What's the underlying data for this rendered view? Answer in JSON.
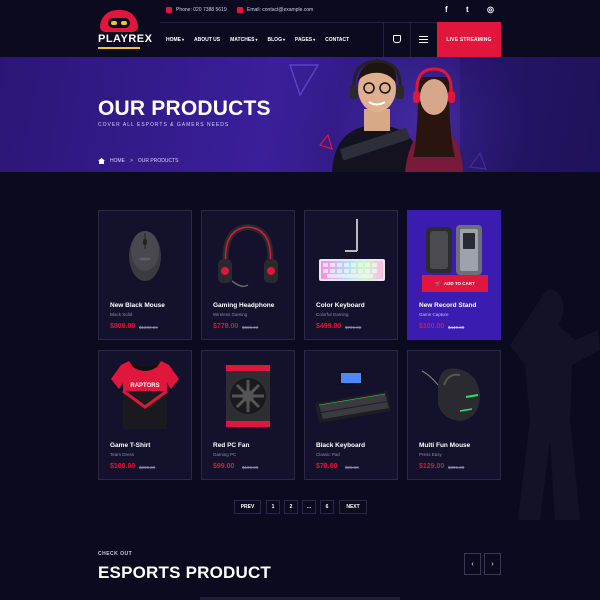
{
  "brand": {
    "name": "PLAYREX",
    "accent": "#e1163c",
    "yellow": "#f2c230"
  },
  "topbar": {
    "phone": "Phone: 020 7388 5619",
    "email": "Email: contact@example.com",
    "social": [
      {
        "icon": "facebook-icon",
        "glyph": "f"
      },
      {
        "icon": "twitter-icon",
        "glyph": "t"
      },
      {
        "icon": "instagram-icon",
        "glyph": "◎"
      }
    ]
  },
  "nav": {
    "items": [
      {
        "label": "HOME",
        "dropdown": true
      },
      {
        "label": "ABOUT US",
        "dropdown": false
      },
      {
        "label": "MATCHES",
        "dropdown": true
      },
      {
        "label": "BLOG",
        "dropdown": true
      },
      {
        "label": "PAGES",
        "dropdown": true
      },
      {
        "label": "CONTACT",
        "dropdown": false
      }
    ],
    "live_label": "LIVE STREAMING"
  },
  "banner": {
    "title": "OUR PRODUCTS",
    "subtitle": "COVER ALL ESPORTS & GAMERS NEEDS",
    "breadcrumb": [
      "HOME",
      ">",
      "OUR PRODUCTS"
    ]
  },
  "products": [
    {
      "name": "New Black Mouse",
      "sub": "Black Solid",
      "price": "$800.00",
      "old": "$1200.00",
      "kind": "mouse"
    },
    {
      "name": "Gaming Headphone",
      "sub": "Wireless Gaming",
      "price": "$778.00",
      "old": "$899.00",
      "kind": "headphone"
    },
    {
      "name": "Color Keyboard",
      "sub": "Colorful Gaming",
      "price": "$499.00",
      "old": "$799.00",
      "kind": "keyboard"
    },
    {
      "name": "New Record Stand",
      "sub": "Game Capture",
      "price": "$100.00",
      "old": "$440.00",
      "kind": "capture",
      "active": true
    },
    {
      "name": "Game T-Shirt",
      "sub": "Team Dress",
      "price": "$100.00",
      "old": "$800.00",
      "kind": "tshirt"
    },
    {
      "name": "Red PC Fan",
      "sub": "Gaming PC",
      "price": "$99.00",
      "old": "$199.00",
      "kind": "fan"
    },
    {
      "name": "Black Keyboard",
      "sub": "Classic Pad",
      "price": "$78.00",
      "old": "$98.00",
      "kind": "blackkeyboard"
    },
    {
      "name": "Multi Fun Mouse",
      "sub": "Press Easy",
      "price": "$129.00",
      "old": "$399.00",
      "kind": "rgbmouse"
    }
  ],
  "add_to_cart_label": "ADD TO CART",
  "pagination": [
    "PREV",
    "1",
    "2",
    "...",
    "6",
    "NEXT"
  ],
  "section": {
    "eyebrow": "CHECK OUT",
    "title": "ESPORTS PRODUCT",
    "prev_glyph": "‹",
    "next_glyph": "›"
  }
}
